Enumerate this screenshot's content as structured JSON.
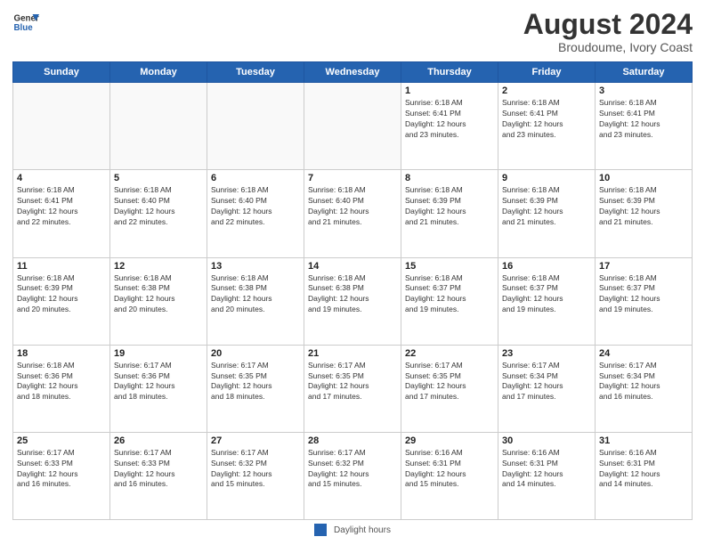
{
  "header": {
    "logo_line1": "General",
    "logo_line2": "Blue",
    "month": "August 2024",
    "location": "Broudoume, Ivory Coast"
  },
  "days_of_week": [
    "Sunday",
    "Monday",
    "Tuesday",
    "Wednesday",
    "Thursday",
    "Friday",
    "Saturday"
  ],
  "weeks": [
    [
      {
        "day": "",
        "info": ""
      },
      {
        "day": "",
        "info": ""
      },
      {
        "day": "",
        "info": ""
      },
      {
        "day": "",
        "info": ""
      },
      {
        "day": "1",
        "info": "Sunrise: 6:18 AM\nSunset: 6:41 PM\nDaylight: 12 hours\nand 23 minutes."
      },
      {
        "day": "2",
        "info": "Sunrise: 6:18 AM\nSunset: 6:41 PM\nDaylight: 12 hours\nand 23 minutes."
      },
      {
        "day": "3",
        "info": "Sunrise: 6:18 AM\nSunset: 6:41 PM\nDaylight: 12 hours\nand 23 minutes."
      }
    ],
    [
      {
        "day": "4",
        "info": "Sunrise: 6:18 AM\nSunset: 6:41 PM\nDaylight: 12 hours\nand 22 minutes."
      },
      {
        "day": "5",
        "info": "Sunrise: 6:18 AM\nSunset: 6:40 PM\nDaylight: 12 hours\nand 22 minutes."
      },
      {
        "day": "6",
        "info": "Sunrise: 6:18 AM\nSunset: 6:40 PM\nDaylight: 12 hours\nand 22 minutes."
      },
      {
        "day": "7",
        "info": "Sunrise: 6:18 AM\nSunset: 6:40 PM\nDaylight: 12 hours\nand 21 minutes."
      },
      {
        "day": "8",
        "info": "Sunrise: 6:18 AM\nSunset: 6:39 PM\nDaylight: 12 hours\nand 21 minutes."
      },
      {
        "day": "9",
        "info": "Sunrise: 6:18 AM\nSunset: 6:39 PM\nDaylight: 12 hours\nand 21 minutes."
      },
      {
        "day": "10",
        "info": "Sunrise: 6:18 AM\nSunset: 6:39 PM\nDaylight: 12 hours\nand 21 minutes."
      }
    ],
    [
      {
        "day": "11",
        "info": "Sunrise: 6:18 AM\nSunset: 6:39 PM\nDaylight: 12 hours\nand 20 minutes."
      },
      {
        "day": "12",
        "info": "Sunrise: 6:18 AM\nSunset: 6:38 PM\nDaylight: 12 hours\nand 20 minutes."
      },
      {
        "day": "13",
        "info": "Sunrise: 6:18 AM\nSunset: 6:38 PM\nDaylight: 12 hours\nand 20 minutes."
      },
      {
        "day": "14",
        "info": "Sunrise: 6:18 AM\nSunset: 6:38 PM\nDaylight: 12 hours\nand 19 minutes."
      },
      {
        "day": "15",
        "info": "Sunrise: 6:18 AM\nSunset: 6:37 PM\nDaylight: 12 hours\nand 19 minutes."
      },
      {
        "day": "16",
        "info": "Sunrise: 6:18 AM\nSunset: 6:37 PM\nDaylight: 12 hours\nand 19 minutes."
      },
      {
        "day": "17",
        "info": "Sunrise: 6:18 AM\nSunset: 6:37 PM\nDaylight: 12 hours\nand 19 minutes."
      }
    ],
    [
      {
        "day": "18",
        "info": "Sunrise: 6:18 AM\nSunset: 6:36 PM\nDaylight: 12 hours\nand 18 minutes."
      },
      {
        "day": "19",
        "info": "Sunrise: 6:17 AM\nSunset: 6:36 PM\nDaylight: 12 hours\nand 18 minutes."
      },
      {
        "day": "20",
        "info": "Sunrise: 6:17 AM\nSunset: 6:35 PM\nDaylight: 12 hours\nand 18 minutes."
      },
      {
        "day": "21",
        "info": "Sunrise: 6:17 AM\nSunset: 6:35 PM\nDaylight: 12 hours\nand 17 minutes."
      },
      {
        "day": "22",
        "info": "Sunrise: 6:17 AM\nSunset: 6:35 PM\nDaylight: 12 hours\nand 17 minutes."
      },
      {
        "day": "23",
        "info": "Sunrise: 6:17 AM\nSunset: 6:34 PM\nDaylight: 12 hours\nand 17 minutes."
      },
      {
        "day": "24",
        "info": "Sunrise: 6:17 AM\nSunset: 6:34 PM\nDaylight: 12 hours\nand 16 minutes."
      }
    ],
    [
      {
        "day": "25",
        "info": "Sunrise: 6:17 AM\nSunset: 6:33 PM\nDaylight: 12 hours\nand 16 minutes."
      },
      {
        "day": "26",
        "info": "Sunrise: 6:17 AM\nSunset: 6:33 PM\nDaylight: 12 hours\nand 16 minutes."
      },
      {
        "day": "27",
        "info": "Sunrise: 6:17 AM\nSunset: 6:32 PM\nDaylight: 12 hours\nand 15 minutes."
      },
      {
        "day": "28",
        "info": "Sunrise: 6:17 AM\nSunset: 6:32 PM\nDaylight: 12 hours\nand 15 minutes."
      },
      {
        "day": "29",
        "info": "Sunrise: 6:16 AM\nSunset: 6:31 PM\nDaylight: 12 hours\nand 15 minutes."
      },
      {
        "day": "30",
        "info": "Sunrise: 6:16 AM\nSunset: 6:31 PM\nDaylight: 12 hours\nand 14 minutes."
      },
      {
        "day": "31",
        "info": "Sunrise: 6:16 AM\nSunset: 6:31 PM\nDaylight: 12 hours\nand 14 minutes."
      }
    ]
  ],
  "footer": {
    "legend_label": "Daylight hours"
  }
}
